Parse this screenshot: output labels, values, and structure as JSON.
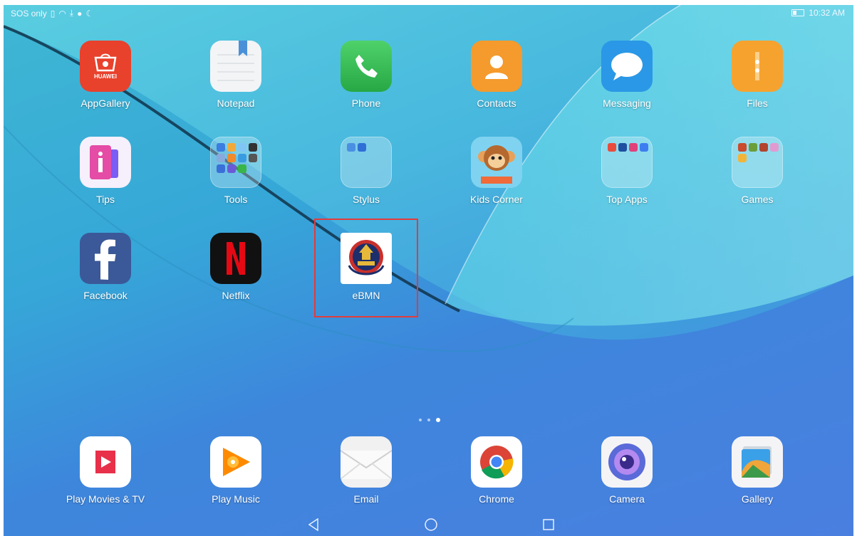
{
  "status_bar": {
    "carrier": "SOS only",
    "time": "10:32 AM"
  },
  "apps": {
    "appgallery": {
      "label": "AppGallery",
      "brand": "HUAWEI"
    },
    "notepad": {
      "label": "Notepad"
    },
    "phone": {
      "label": "Phone"
    },
    "contacts": {
      "label": "Contacts"
    },
    "messaging": {
      "label": "Messaging"
    },
    "files": {
      "label": "Files"
    },
    "tips": {
      "label": "Tips"
    },
    "tools": {
      "label": "Tools"
    },
    "stylus": {
      "label": "Stylus"
    },
    "kids_corner": {
      "label": "Kids Corner"
    },
    "top_apps": {
      "label": "Top Apps"
    },
    "games": {
      "label": "Games"
    },
    "facebook": {
      "label": "Facebook"
    },
    "netflix": {
      "label": "Netflix"
    },
    "ebmn": {
      "label": "eBMN"
    }
  },
  "dock": {
    "play_movies": {
      "label": "Play Movies & TV"
    },
    "play_music": {
      "label": "Play Music"
    },
    "email": {
      "label": "Email"
    },
    "chrome": {
      "label": "Chrome"
    },
    "camera": {
      "label": "Camera"
    },
    "gallery": {
      "label": "Gallery"
    }
  },
  "page_indicator": {
    "pages": 3,
    "current": 3
  },
  "highlight_color": "#e23b3b"
}
